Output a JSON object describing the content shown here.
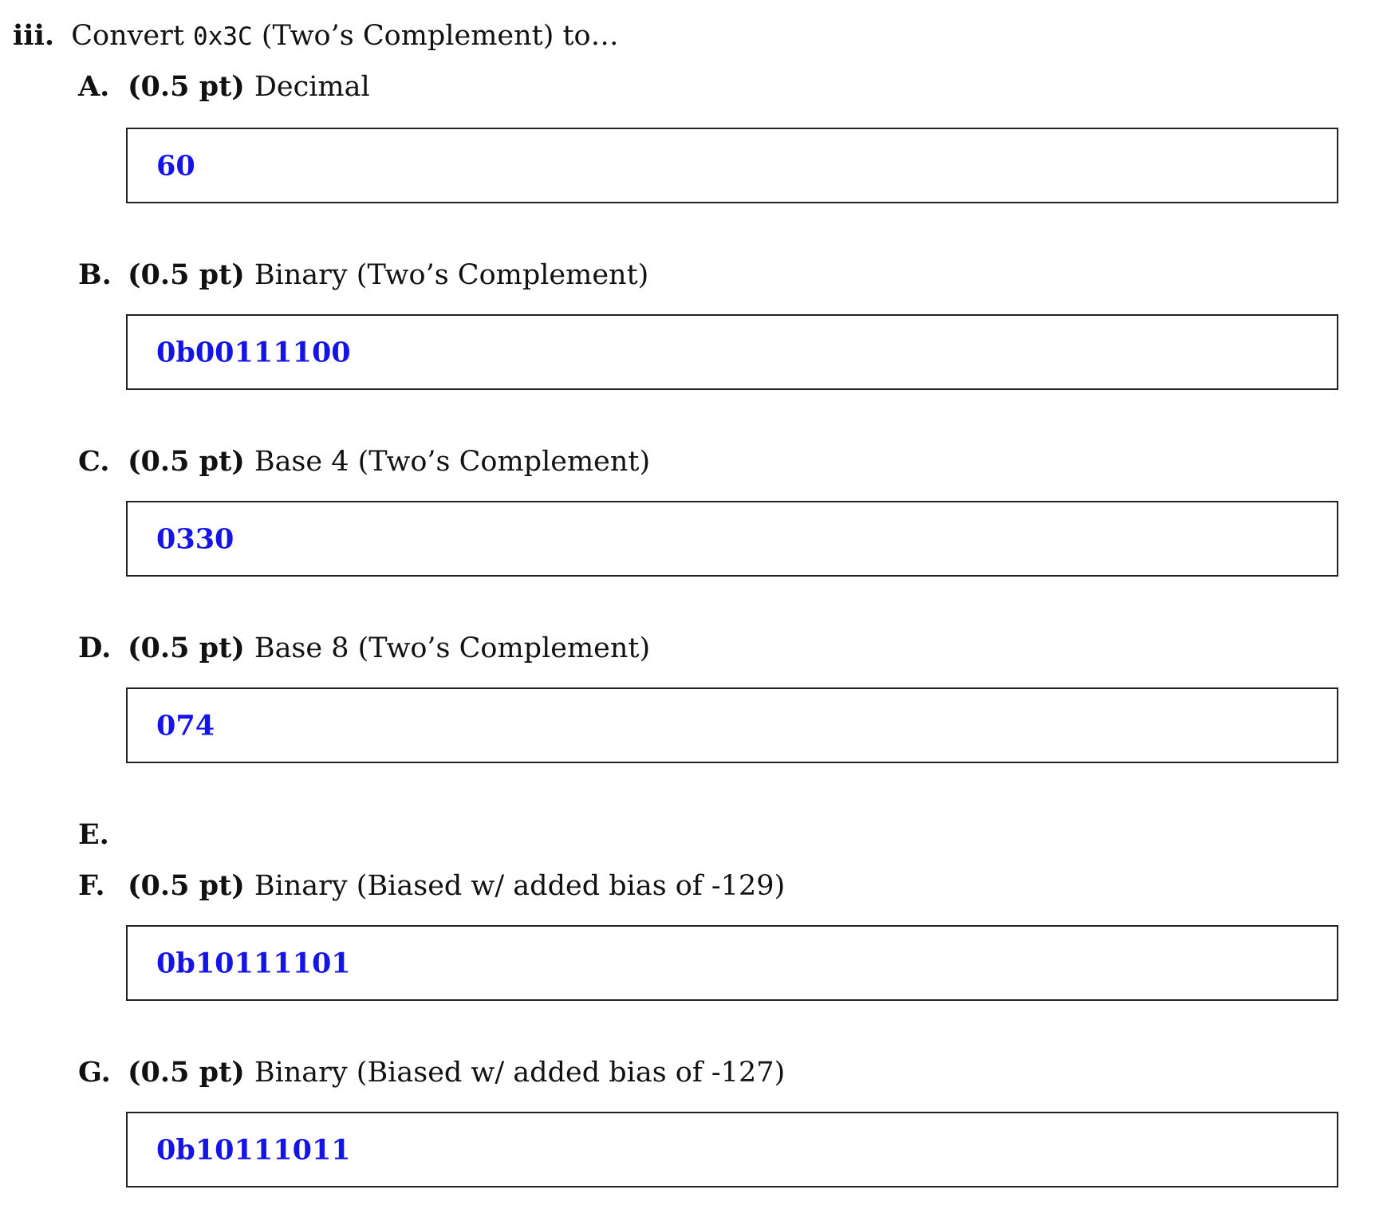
{
  "question": {
    "number": "iii.",
    "prefix": "Convert",
    "code": "0x3C",
    "suffix": "(Two’s Complement) to…"
  },
  "parts": [
    {
      "letter": "A.",
      "points": "(0.5 pt)",
      "prompt": "Decimal",
      "answer": "60"
    },
    {
      "letter": "B.",
      "points": "(0.5 pt)",
      "prompt": "Binary (Two’s Complement)",
      "answer": "0b00111100"
    },
    {
      "letter": "C.",
      "points": "(0.5 pt)",
      "prompt": "Base 4 (Two’s Complement)",
      "answer": "0330"
    },
    {
      "letter": "D.",
      "points": "(0.5 pt)",
      "prompt": "Base 8 (Two’s Complement)",
      "answer": "074"
    },
    {
      "letter": "E.",
      "points": "",
      "prompt": "",
      "answer": null
    },
    {
      "letter": "F.",
      "points": "(0.5 pt)",
      "prompt": "Binary (Biased w/ added bias of -129)",
      "answer": "0b10111101"
    },
    {
      "letter": "G.",
      "points": "(0.5 pt)",
      "prompt": "Binary (Biased w/ added bias of -127)",
      "answer": "0b10111011"
    }
  ],
  "colors": {
    "answer_text": "#1414e6",
    "box_border": "#222222",
    "text": "#111111"
  }
}
